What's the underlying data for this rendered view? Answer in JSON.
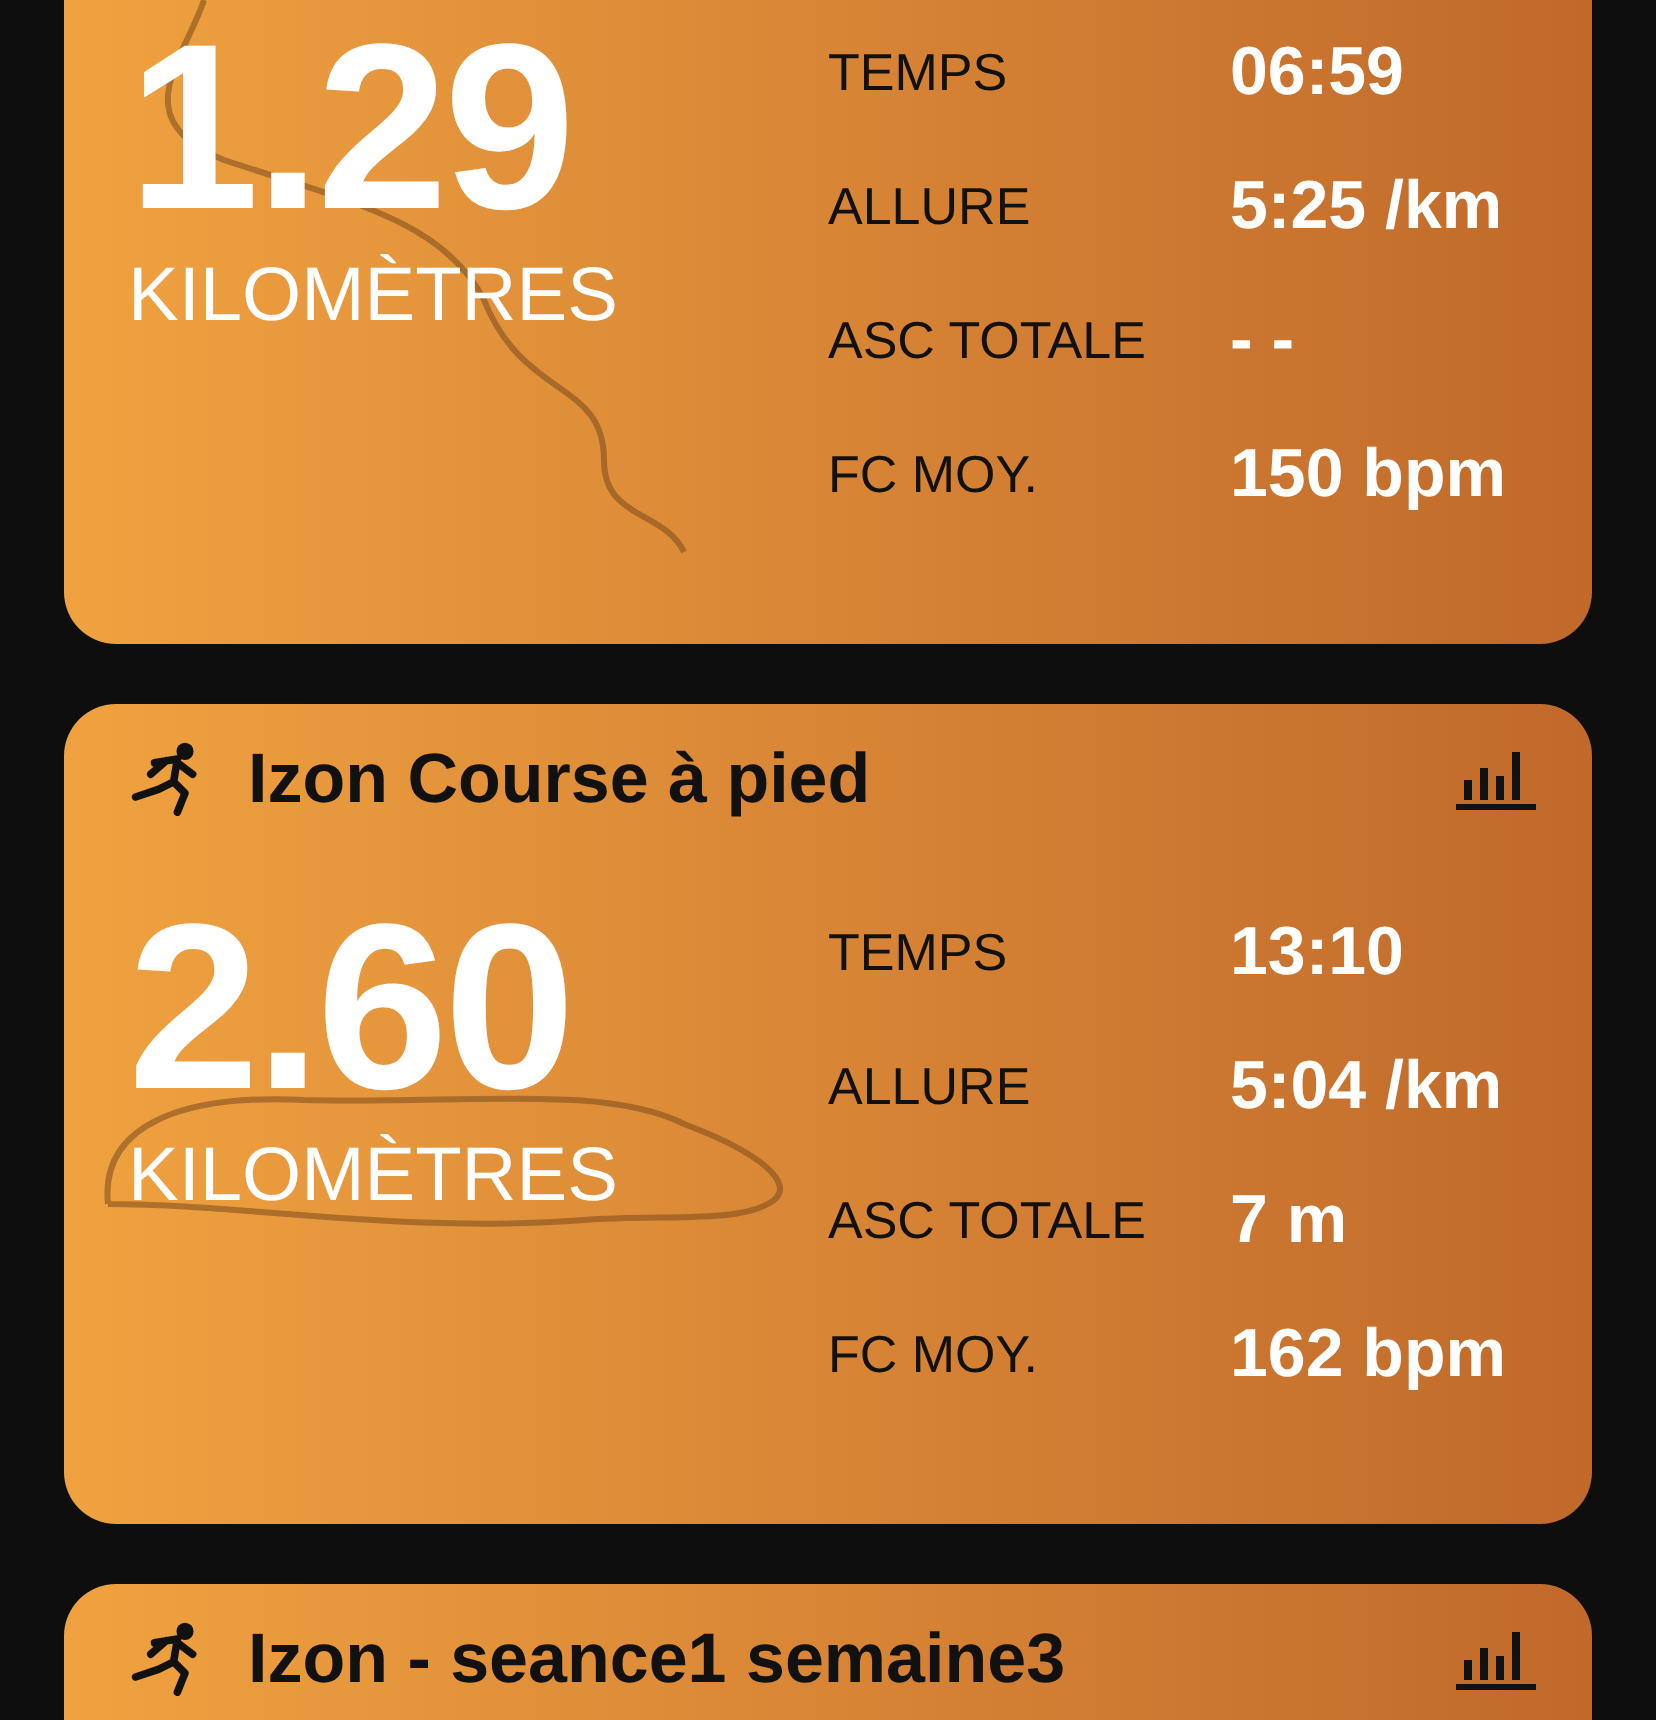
{
  "workouts": [
    {
      "distance": "1.29",
      "unit": "KILOMÈTRES",
      "stats": [
        {
          "label": "TEMPS",
          "value": "06:59"
        },
        {
          "label": "ALLURE",
          "value": "5:25 /km"
        },
        {
          "label": "ASC TOTALE",
          "value": "- -"
        },
        {
          "label": "FC MOY.",
          "value": "150 bpm"
        }
      ]
    },
    {
      "title": "Izon Course à pied",
      "distance": "2.60",
      "unit": "KILOMÈTRES",
      "stats": [
        {
          "label": "TEMPS",
          "value": "13:10"
        },
        {
          "label": "ALLURE",
          "value": "5:04 /km"
        },
        {
          "label": "ASC TOTALE",
          "value": "7 m"
        },
        {
          "label": "FC MOY.",
          "value": "162 bpm"
        }
      ]
    },
    {
      "title": "Izon - seance1 semaine3"
    }
  ]
}
